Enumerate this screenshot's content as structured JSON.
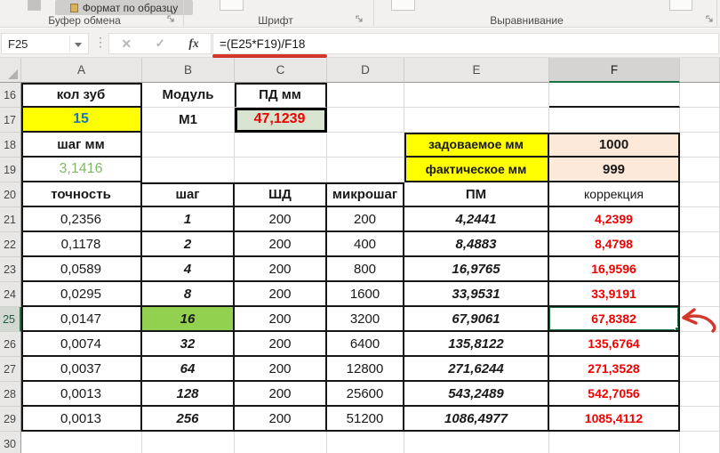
{
  "ribbon": {
    "format_painter": "Формат по образцу",
    "groups": [
      "Буфер обмена",
      "Шрифт",
      "Выравнивание"
    ]
  },
  "formula_bar": {
    "name_box": "F25",
    "cancel": "✕",
    "enter": "✓",
    "fx": "fx",
    "formula": "=(E25*F19)/F18"
  },
  "sheet": {
    "columns": [
      "A",
      "B",
      "C",
      "D",
      "E",
      "F"
    ],
    "selected_column": "F",
    "rows": [
      "16",
      "17",
      "18",
      "19",
      "20",
      "21",
      "22",
      "23",
      "24",
      "25",
      "26",
      "27",
      "28",
      "29",
      "30"
    ],
    "selected_row": "25",
    "selected_cell": "F25"
  },
  "cells": {
    "a16": "кол зуб",
    "b16": "Модуль",
    "c16": "ПД мм",
    "a17": "15",
    "b17": "М1",
    "c17": "47,1239",
    "a18": "шаг мм",
    "e18": "задоваемое мм",
    "f18": "1000",
    "a19": "3,1416",
    "e19": "фактическое мм",
    "f19": "999"
  },
  "table": {
    "headers": {
      "a": "точность",
      "b": "шаг",
      "c": "ШД",
      "d": "микрошаг",
      "e": "ПМ",
      "f": "коррекция"
    },
    "rows": [
      {
        "num": "21",
        "tochnost": "0,2356",
        "shag": "1",
        "shd": "200",
        "mikroshag": "200",
        "pm": "4,2441",
        "korrekcia": "4,2399"
      },
      {
        "num": "22",
        "tochnost": "0,1178",
        "shag": "2",
        "shd": "200",
        "mikroshag": "400",
        "pm": "8,4883",
        "korrekcia": "8,4798"
      },
      {
        "num": "23",
        "tochnost": "0,0589",
        "shag": "4",
        "shd": "200",
        "mikroshag": "800",
        "pm": "16,9765",
        "korrekcia": "16,9596"
      },
      {
        "num": "24",
        "tochnost": "0,0295",
        "shag": "8",
        "shd": "200",
        "mikroshag": "1600",
        "pm": "33,9531",
        "korrekcia": "33,9191"
      },
      {
        "num": "25",
        "tochnost": "0,0147",
        "shag": "16",
        "shd": "200",
        "mikroshag": "3200",
        "pm": "67,9061",
        "korrekcia": "67,8382",
        "shag_highlight": true,
        "selected": true
      },
      {
        "num": "26",
        "tochnost": "0,0074",
        "shag": "32",
        "shd": "200",
        "mikroshag": "6400",
        "pm": "135,8122",
        "korrekcia": "135,6764"
      },
      {
        "num": "27",
        "tochnost": "0,0037",
        "shag": "64",
        "shd": "200",
        "mikroshag": "12800",
        "pm": "271,6244",
        "korrekcia": "271,3528"
      },
      {
        "num": "28",
        "tochnost": "0,0013",
        "shag": "128",
        "shd": "200",
        "mikroshag": "25600",
        "pm": "543,2489",
        "korrekcia": "542,7056"
      },
      {
        "num": "29",
        "tochnost": "0,0013",
        "shag": "256",
        "shd": "200",
        "mikroshag": "51200",
        "pm": "1086,4977",
        "korrekcia": "1085,4112"
      }
    ]
  },
  "colors": {
    "yellow_fill": "#FFFF00",
    "green_fill": "#92D050",
    "sage_fill": "#D8E4D0",
    "cream_fill": "#FCE9D9",
    "selection_green": "#1E7145",
    "value_red": "#F00000",
    "value_blue": "#1F75BB",
    "value_green": "#84B868",
    "annotation_red": "#D3362A"
  }
}
